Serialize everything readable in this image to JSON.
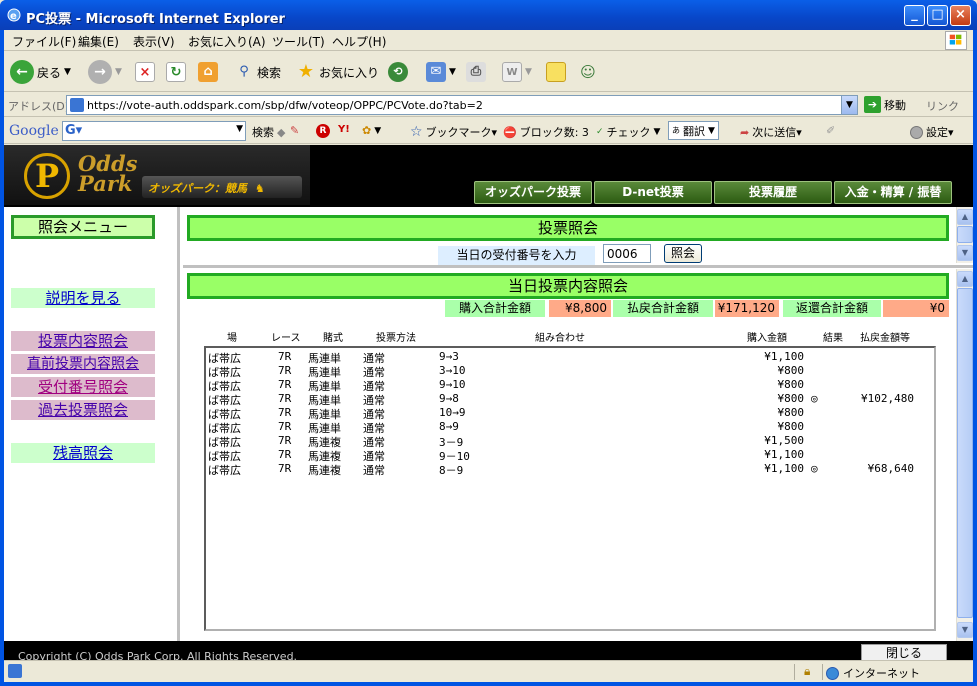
{
  "window": {
    "title": "PC投票 - Microsoft Internet Explorer",
    "minimize": "_",
    "maximize": "□",
    "close": "×"
  },
  "menu": {
    "file": "ファイル(F)",
    "edit": "編集(E)",
    "view": "表示(V)",
    "favorites": "お気に入り(A)",
    "tools": "ツール(T)",
    "help": "ヘルプ(H)"
  },
  "toolbar": {
    "back": "戻る",
    "search": "検索",
    "favorites": "お気に入り"
  },
  "address": {
    "label": "アドレス(D)",
    "url": "https://vote-auth.oddspark.com/sbp/dfw/voteop/OPPC/PCVote.do?tab=2",
    "go": "移動",
    "links": "リンク"
  },
  "google": {
    "logo": "Google",
    "search": "検索",
    "bookmarks": "ブックマーク▾",
    "blocked": "ブロック数: 3",
    "check": "チェック",
    "translate": "翻訳",
    "send": "次に送信▾",
    "settings": "設定▾"
  },
  "site": {
    "logo_top": "Odds",
    "logo_bottom": "Park",
    "logo_sub": "オッズパーク：競馬",
    "nav": [
      "オッズパーク投票",
      "D-net投票",
      "投票履歴",
      "入金・精算 / 振替"
    ]
  },
  "left_menu": {
    "title": "照会メニュー",
    "help": "説明を見る",
    "items": [
      "投票内容照会",
      "直前投票内容照会",
      "受付番号照会",
      "過去投票照会"
    ],
    "balance": "残高照会"
  },
  "query": {
    "title": "投票照会",
    "input_label": "当日の受付番号を入力",
    "input_value": "0006",
    "button": "照会"
  },
  "details": {
    "title": "当日投票内容照会",
    "purchase_label": "購入合計金額",
    "purchase_value": "¥8,800",
    "refund_label": "払戻合計金額",
    "refund_value": "¥171,120",
    "return_label": "返還合計金額",
    "return_value": "¥0",
    "columns": [
      "場",
      "レース",
      "賭式",
      "投票方法",
      "組み合わせ",
      "購入金額",
      "結果",
      "払戻金額等"
    ],
    "rows": [
      [
        "ば帯広",
        "7R",
        "馬連単",
        "通常",
        "9→3",
        "¥1,100",
        "",
        ""
      ],
      [
        "ば帯広",
        "7R",
        "馬連単",
        "通常",
        "3→10",
        "¥800",
        "",
        ""
      ],
      [
        "ば帯広",
        "7R",
        "馬連単",
        "通常",
        "9→10",
        "¥800",
        "",
        ""
      ],
      [
        "ば帯広",
        "7R",
        "馬連単",
        "通常",
        "9→8",
        "¥800",
        "◎",
        "¥102,480"
      ],
      [
        "ば帯広",
        "7R",
        "馬連単",
        "通常",
        "10→9",
        "¥800",
        "",
        ""
      ],
      [
        "ば帯広",
        "7R",
        "馬連単",
        "通常",
        "8→9",
        "¥800",
        "",
        ""
      ],
      [
        "ば帯広",
        "7R",
        "馬連複",
        "通常",
        "3－9",
        "¥1,500",
        "",
        ""
      ],
      [
        "ば帯広",
        "7R",
        "馬連複",
        "通常",
        "9－10",
        "¥1,100",
        "",
        ""
      ],
      [
        "ば帯広",
        "7R",
        "馬連複",
        "通常",
        "8－9",
        "¥1,100",
        "◎",
        "¥68,640"
      ]
    ]
  },
  "footer": {
    "copyright": "Copyright (C) Odds Park Corp. All Rights Reserved.",
    "close": "閉じる"
  },
  "status": {
    "zone": "インターネット"
  }
}
